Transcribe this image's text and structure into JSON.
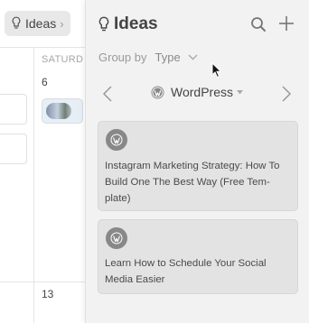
{
  "calendar": {
    "tab_label": "Ideas",
    "day_header": "SATURD",
    "day_numbers": [
      "6",
      "13"
    ]
  },
  "panel": {
    "title": "Ideas",
    "group_by_label": "Group by",
    "group_by_value": "Type",
    "nav_label": "WordPress",
    "cards": [
      {
        "title": "Instagram Marketing Strategy: How To Build One The Best Way (Free Tem-plate)",
        "lines": [
          "Instagram Marketing Strategy: How To",
          "Build One The Best Way (Free Tem-",
          "plate)"
        ]
      },
      {
        "title": "Learn How to Schedule Your Social Media Easier",
        "lines": [
          "Learn How to Schedule Your Social",
          "Media Easier"
        ]
      }
    ]
  },
  "colors": {
    "accent": "#444444",
    "muted": "#9a9a9a",
    "card_bg": "#e3e3e3",
    "badge": "#888888"
  },
  "icons": [
    "lightbulb-icon",
    "search-icon",
    "plus-icon",
    "chevron-left-icon",
    "chevron-right-icon",
    "wordpress-icon",
    "chevron-down-icon",
    "cursor-icon"
  ]
}
